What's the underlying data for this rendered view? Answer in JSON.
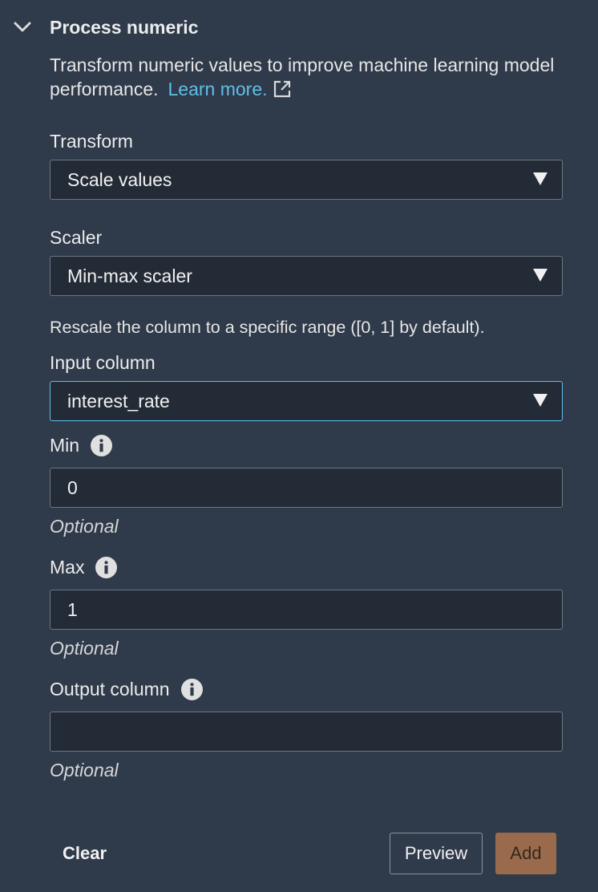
{
  "section": {
    "title": "Process numeric",
    "description": "Transform numeric values to improve machine learning model performance.",
    "learn_more": "Learn more."
  },
  "transform": {
    "label": "Transform",
    "value": "Scale values"
  },
  "scaler": {
    "label": "Scaler",
    "value": "Min-max scaler",
    "description": "Rescale the column to a specific range ([0, 1] by default)."
  },
  "input_column": {
    "label": "Input column",
    "value": "interest_rate"
  },
  "min": {
    "label": "Min",
    "value": "0",
    "hint": "Optional"
  },
  "max": {
    "label": "Max",
    "value": "1",
    "hint": "Optional"
  },
  "output_column": {
    "label": "Output column",
    "value": "",
    "hint": "Optional"
  },
  "actions": {
    "clear": "Clear",
    "preview": "Preview",
    "add": "Add"
  },
  "colors": {
    "background": "#2f3a4a",
    "field_background": "#232b36",
    "link": "#5fbfe8",
    "focus_border": "#5fbfe8",
    "primary_button": "#9a6a4d"
  },
  "icons": {
    "collapse": "chevron-down-icon",
    "external": "external-link-icon",
    "info": "info-icon",
    "dropdown": "caret-down-icon"
  }
}
